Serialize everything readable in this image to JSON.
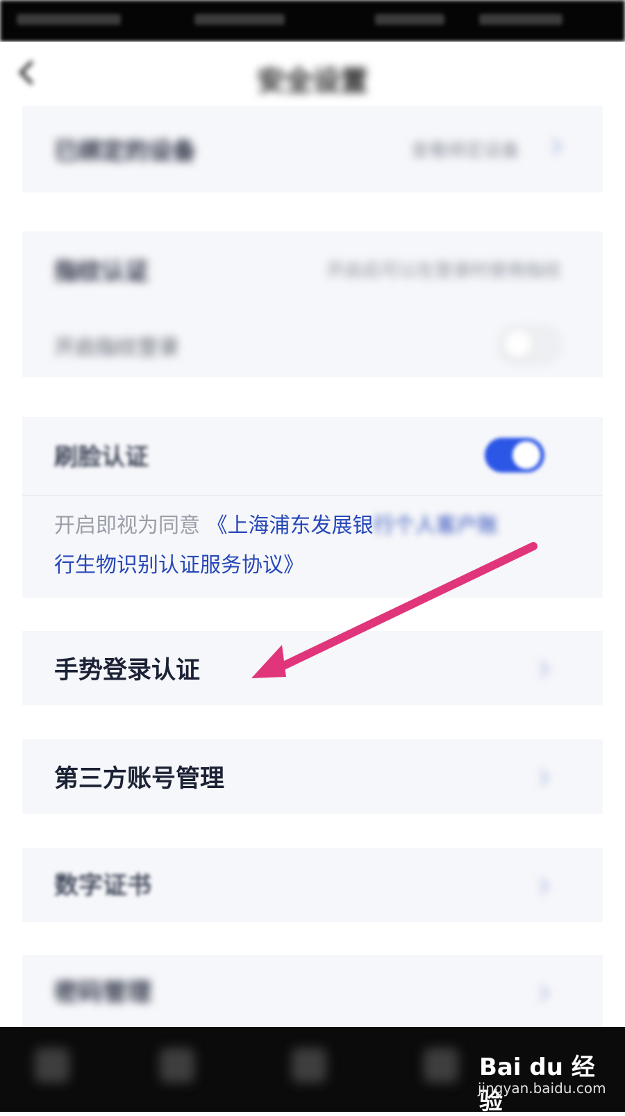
{
  "nav": {
    "title": "安全设置"
  },
  "group_top": {
    "label": "已绑定的设备",
    "value": "查看绑定设备"
  },
  "group_fingerprint": {
    "label": "指纹认证",
    "note": "开启后可以在登录时使用指纹",
    "sub_label": "开启指纹登录"
  },
  "face_auth": {
    "label": "刷脸认证",
    "toggle_state": "on",
    "agreement_prefix": "开启即视为同意",
    "agreement_link_visible": "《上海浦东发展银",
    "agreement_link_blurred": "行个人客户账",
    "agreement_link_line2": "行生物识别认证服务协议》"
  },
  "gesture_login": {
    "label": "手势登录认证"
  },
  "third_party": {
    "label": "第三方账号管理"
  },
  "digital_cert": {
    "label": "数字证书"
  },
  "bottom_item": {
    "label": "密码管理"
  },
  "watermark": {
    "main": "Bai du 经验",
    "url": "jingyan.baidu.com"
  },
  "colors": {
    "accent_blue": "#2c56e6",
    "arrow_pink": "#e0357a",
    "link_blue": "#2747b8"
  }
}
